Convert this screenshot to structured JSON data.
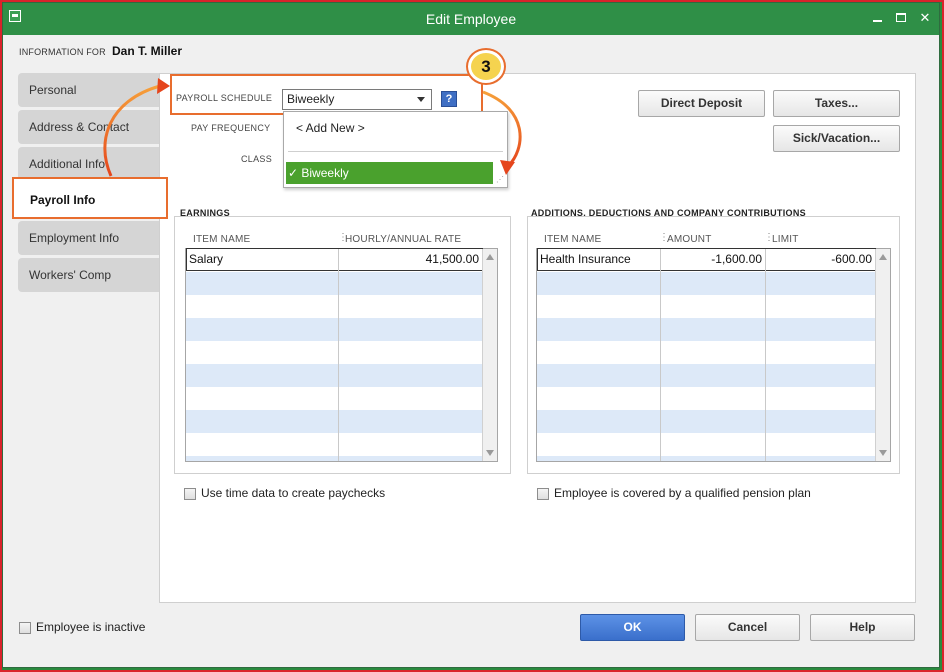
{
  "window": {
    "title": "Edit Employee",
    "minimize_label": "",
    "maximize_label": "",
    "close_label": "✕"
  },
  "header": {
    "info_for_label": "INFORMATION FOR",
    "employee_name": "Dan T. Miller"
  },
  "sidebar": {
    "items": [
      {
        "label": "Personal",
        "active": false
      },
      {
        "label": "Address & Contact",
        "active": false
      },
      {
        "label": "Additional Info",
        "active": false
      },
      {
        "label": "Payroll Info",
        "active": true
      },
      {
        "label": "Employment Info",
        "active": false
      },
      {
        "label": "Workers' Comp",
        "active": false
      }
    ]
  },
  "payroll": {
    "schedule_label": "PAYROLL SCHEDULE",
    "schedule_value": "Biweekly",
    "help_label": "?",
    "pay_frequency_label": "PAY FREQUENCY",
    "class_label": "CLASS",
    "dropdown": {
      "add_new": "< Add New >",
      "selected_option": "✓ Biweekly"
    },
    "step_number": "3"
  },
  "buttons": {
    "direct_deposit": "Direct Deposit",
    "taxes": "Taxes...",
    "sick_vacation": "Sick/Vacation...",
    "ok": "OK",
    "cancel": "Cancel",
    "help": "Help"
  },
  "earnings": {
    "title": "EARNINGS",
    "columns": [
      "ITEM NAME",
      "HOURLY/ANNUAL RATE"
    ],
    "rows": [
      {
        "item": "Salary",
        "rate": "41,500.00"
      }
    ]
  },
  "additions": {
    "title": "ADDITIONS, DEDUCTIONS AND COMPANY CONTRIBUTIONS",
    "columns": [
      "ITEM NAME",
      "AMOUNT",
      "LIMIT"
    ],
    "rows": [
      {
        "item": "Health Insurance",
        "amount": "-1,600.00",
        "limit": "-600.00"
      }
    ]
  },
  "checkboxes": {
    "use_time_data": {
      "label": "Use time data to create paychecks",
      "checked": false
    },
    "pension_plan": {
      "label": "Employee is covered by a qualified pension plan",
      "checked": false
    },
    "inactive": {
      "label": "Employee is inactive",
      "checked": false
    }
  },
  "colors": {
    "titlebar": "#2f8f47",
    "highlight": "#e86d2e",
    "selected_option": "#4aa12d",
    "primary_button": "#3a6fcb",
    "grid_alt_row": "#dde9f8"
  }
}
